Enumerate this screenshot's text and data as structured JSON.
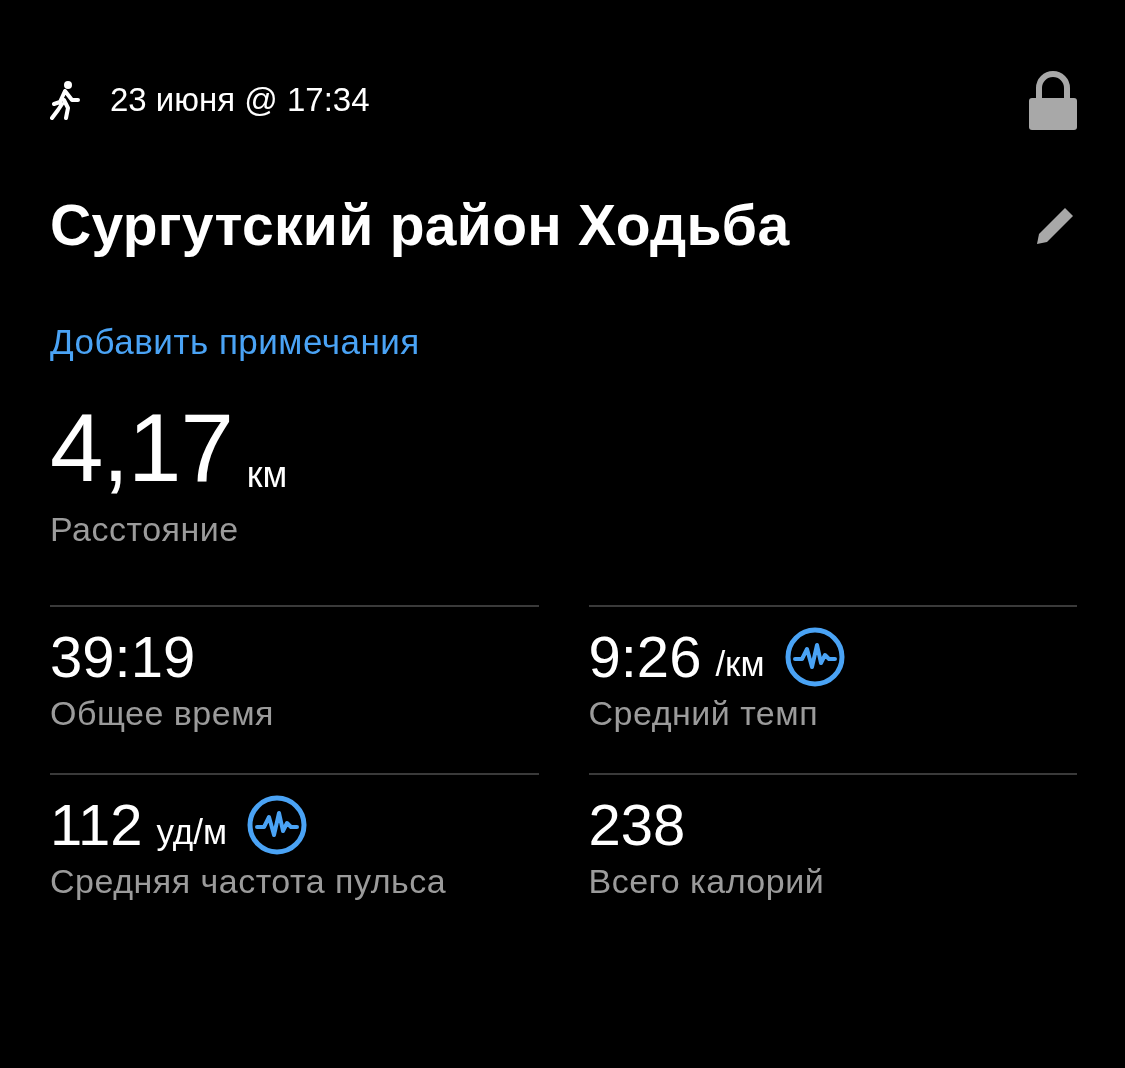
{
  "header": {
    "date": "23 июня @ 17:34",
    "locked": true
  },
  "title": "Сургутский район Ходьба",
  "notes_link": "Добавить примечания",
  "distance": {
    "value": "4,17",
    "unit": "км",
    "label": "Расстояние"
  },
  "stats": [
    {
      "value": "39:19",
      "label": "Общее время",
      "details_icon": false
    },
    {
      "value": "9:26",
      "unit": "/км",
      "label": "Средний темп",
      "details_icon": true
    },
    {
      "value": "112",
      "unit": "уд/м",
      "label": "Средняя частота пульса",
      "details_icon": true
    },
    {
      "value": "238",
      "label": "Всего калорий",
      "details_icon": false
    }
  ]
}
